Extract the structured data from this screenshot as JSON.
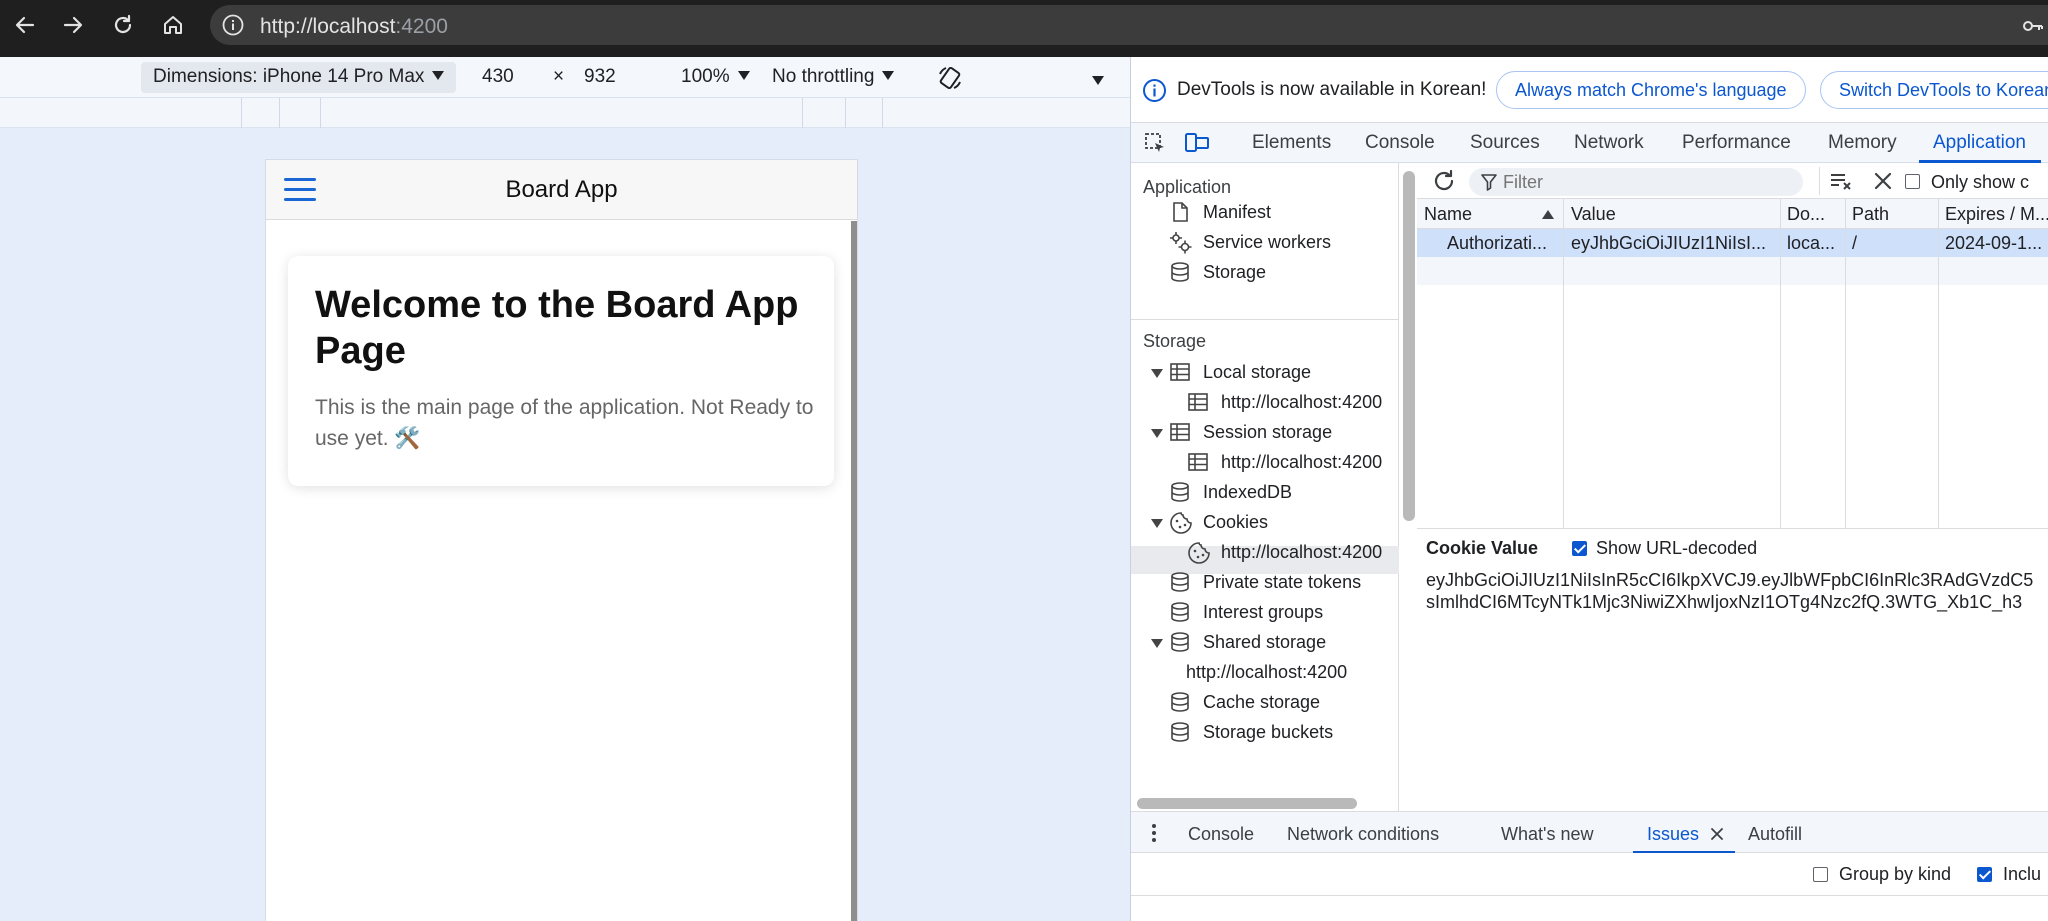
{
  "browser": {
    "url_host": "http://localhost",
    "url_port": ":4200",
    "icons": [
      "back-arrow-icon",
      "forward-arrow-icon",
      "reload-icon",
      "home-icon",
      "info-icon",
      "key-icon"
    ]
  },
  "device_toolbar": {
    "dimensions": "Dimensions: iPhone 14 Pro Max",
    "width": "430",
    "times": "×",
    "height": "932",
    "zoom": "100%",
    "throttling": "No throttling"
  },
  "app": {
    "title": "Board App",
    "heading": "Welcome to the Board App Page",
    "body": "This is the main page of the application. Not Ready to use yet. 🛠️"
  },
  "devtools": {
    "info_text": "DevTools is now available in Korean!",
    "btn_match": "Always match Chrome's language",
    "btn_switch": "Switch DevTools to Korean",
    "tabs": [
      "Elements",
      "Console",
      "Sources",
      "Network",
      "Performance",
      "Memory",
      "Application"
    ],
    "active_tab": "Application",
    "sidebar": {
      "application_header": "Application",
      "manifest": "Manifest",
      "service_workers": "Service workers",
      "storage_item": "Storage",
      "storage_header": "Storage",
      "local_storage": "Local storage",
      "local_storage_origin": "http://localhost:4200",
      "session_storage": "Session storage",
      "session_storage_origin": "http://localhost:4200",
      "indexeddb": "IndexedDB",
      "cookies": "Cookies",
      "cookies_origin": "http://localhost:4200",
      "private_state_tokens": "Private state tokens",
      "interest_groups": "Interest groups",
      "shared_storage": "Shared storage",
      "shared_storage_origin": "http://localhost:4200",
      "cache_storage": "Cache storage",
      "storage_buckets": "Storage buckets"
    },
    "filter_placeholder": "Filter",
    "only_show": "Only show c",
    "columns": [
      "Name",
      "Value",
      "Do...",
      "Path",
      "Expires / M..."
    ],
    "cookie_row": [
      "Authorizati...",
      "eyJhbGciOiJIUzI1NiIsI...",
      "loca...",
      "/",
      "2024-09-1..."
    ],
    "cookie_value_title": "Cookie Value",
    "show_url_decoded": "Show URL-decoded",
    "cookie_value_line1": "eyJhbGciOiJIUzI1NiIsInR5cCI6IkpXVCJ9.eyJlbWFpbCI6InRlc3RAdGVzdC5",
    "cookie_value_line2": "sImlhdCI6MTcyNTk1Mjc3NiwiZXhwIjoxNzI1OTg4Nzc2fQ.3WTG_Xb1C_h3",
    "drawer_tabs": [
      "Console",
      "Network conditions",
      "What's new",
      "Issues",
      "Autofill"
    ],
    "active_drawer_tab": "Issues",
    "group_by_kind": "Group by kind",
    "include": "Inclu"
  }
}
